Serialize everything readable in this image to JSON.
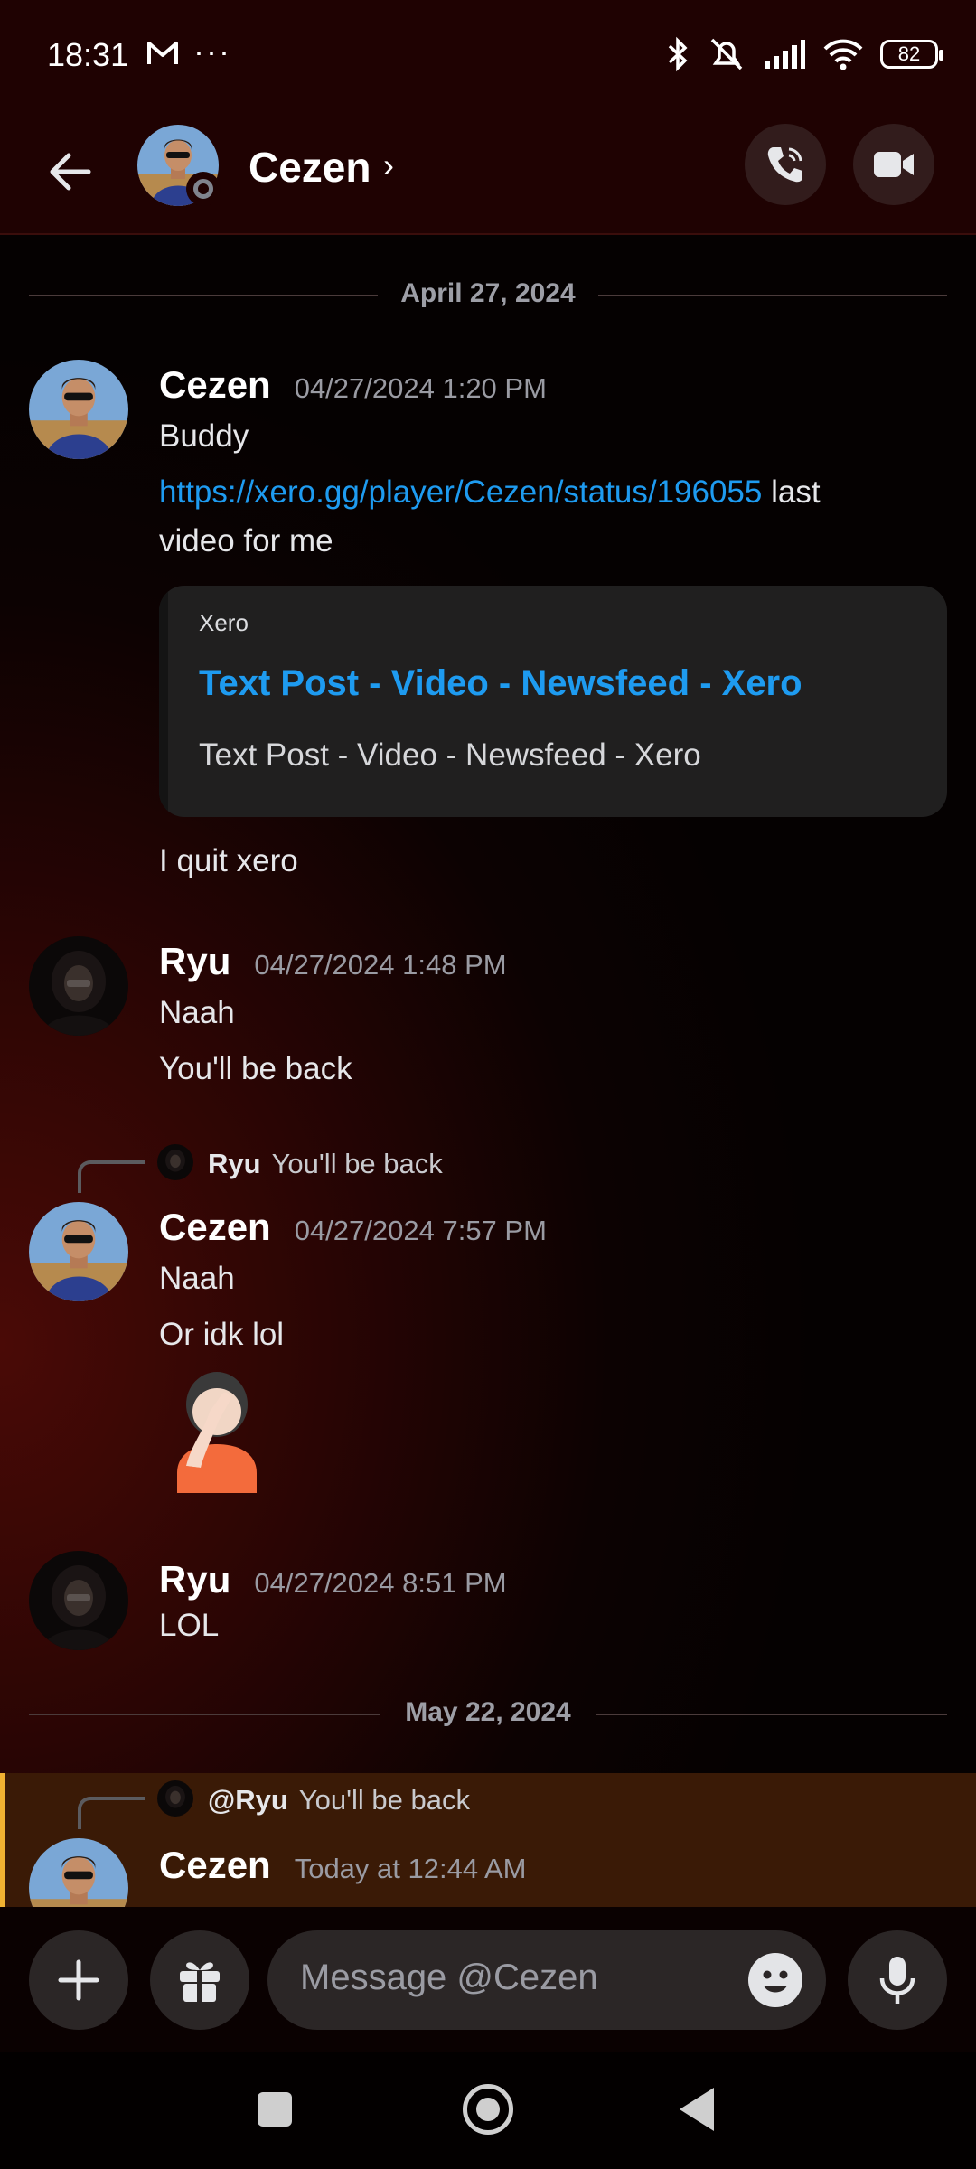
{
  "status_bar": {
    "time": "18:31",
    "more": "···",
    "battery": "82"
  },
  "header": {
    "contact_name": "Cezen",
    "chevron": "›"
  },
  "dividers": {
    "first": "April 27, 2024",
    "second": "May 22, 2024"
  },
  "messages": {
    "m1": {
      "author": "Cezen",
      "time": "04/27/2024 1:20 PM",
      "line1": "Buddy",
      "link": "https://xero.gg/player/Cezen/status/196055",
      "link_suffix": " last",
      "line3": "video for me",
      "embed": {
        "provider": "Xero",
        "title": "Text Post - Video - Newsfeed - Xero",
        "description": "Text Post - Video - Newsfeed - Xero"
      },
      "line4": "I quit xero"
    },
    "m2": {
      "author": "Ryu",
      "time": "04/27/2024 1:48 PM",
      "line1": "Naah",
      "line2": "You'll be back"
    },
    "m3": {
      "reply": {
        "name": "Ryu",
        "text": "You'll be back"
      },
      "author": "Cezen",
      "time": "04/27/2024 7:57 PM",
      "line1": "Naah",
      "line2": "Or idk lol"
    },
    "m4": {
      "author": "Ryu",
      "time": "04/27/2024 8:51 PM",
      "line1": "LOL"
    },
    "m5": {
      "reply": {
        "name": "@Ryu",
        "text": "You'll be back"
      },
      "author": "Cezen",
      "time": "Today at 12:44 AM"
    }
  },
  "composer": {
    "placeholder": "Message @Cezen"
  },
  "colors": {
    "link": "#1e9bf0",
    "mention_highlight": "#f0b232",
    "background": "#2a0504"
  }
}
